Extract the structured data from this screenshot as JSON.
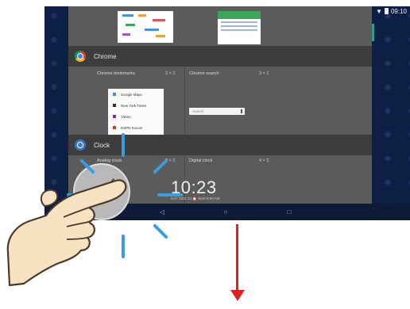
{
  "status_bar": {
    "time": "09:10"
  },
  "sections": [
    {
      "app_name": "Chrome",
      "icon": "chrome-icon"
    },
    {
      "app_name": "Clock",
      "icon": "clock-icon"
    }
  ],
  "chrome_widgets": {
    "bookmarks": {
      "label": "Chrome bookmarks",
      "size": "2 × 2"
    },
    "search": {
      "label": "Chrome search",
      "size": "3 × 1",
      "placeholder": "Search"
    },
    "bookmark_items": [
      {
        "label": "Google Maps",
        "color": "#4285f4"
      },
      {
        "label": "New York Times",
        "color": "#333333"
      },
      {
        "label": "Yahoo",
        "color": "#6d2fb4"
      },
      {
        "label": "ESPN Soccer",
        "color": "#d33a2c"
      }
    ]
  },
  "clock_widgets": {
    "analog": {
      "label": "Analog clock",
      "size": "2 × 2"
    },
    "digital": {
      "label": "Digital clock",
      "size": "4 × 2",
      "time": "10:23",
      "date": "SAT, DEC 14  ⏰ SUN 9:00 AM"
    }
  },
  "nav_bar": {
    "back_icon": "back-triangle-icon",
    "home_icon": "home-circle-icon",
    "recents_icon": "recents-square-icon"
  },
  "colors": {
    "tap_ripple": "#3b9ce0",
    "drag_arrow": "#e02121",
    "wallpaper": "#0e1f45"
  }
}
